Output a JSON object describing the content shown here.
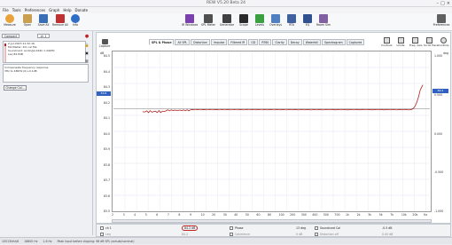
{
  "window": {
    "title": "REW V5.20 Beta 24"
  },
  "menu": [
    "File",
    "Tools",
    "Preferences",
    "Graph",
    "Help",
    "Donate"
  ],
  "toolbar": [
    {
      "label": "Measure",
      "color": "#e8a43a"
    },
    {
      "label": "Open",
      "color": "#c8a050"
    },
    {
      "label": "Save All",
      "color": "#3a6fb5"
    },
    {
      "label": "Remove All",
      "color": "#c03030"
    },
    {
      "label": "Info",
      "color": "#2f6ec4"
    },
    {
      "label": "IR Windows",
      "color": "#7a3fb0"
    },
    {
      "label": "SPL Meter",
      "color": "#505050"
    },
    {
      "label": "Generator",
      "color": "#404040"
    },
    {
      "label": "Scope",
      "color": "#2a2a2a"
    },
    {
      "label": "Levels",
      "color": "#3aa040"
    },
    {
      "label": "Overlays",
      "color": "#5080c0"
    },
    {
      "label": "RTA",
      "color": "#4060a0"
    },
    {
      "label": "EQ",
      "color": "#305090"
    },
    {
      "label": "Room Sim",
      "color": "#8060a0"
    },
    {
      "label": "Preferences",
      "color": "#606060"
    }
  ],
  "panel": {
    "compact_label": "Compact",
    "measurement_name": "ch 1",
    "info_lines": [
      "2-Jul-2023 21:32:16",
      "Mic/Meter: Rm cal file",
      "Soundcard: Audio/Jack44k 1.44KHz",
      "Leq 84.8dB"
    ],
    "notes_lines": [
      "Compensate frequency response",
      "3Hz to 48KHz (0/+0.1dB"
    ],
    "change_cal_label": "Change Cal..."
  },
  "graph": {
    "capture_label": "Capture",
    "tabs": [
      "SPL & Phase",
      "All SPL",
      "Distortion",
      "Impulse",
      "Filtered IR",
      "GD",
      "RT60",
      "Clarity",
      "Decay",
      "Waterfall",
      "Spectrogram",
      "Captured"
    ],
    "active_tab": "SPL & Phase",
    "tools": [
      "Controls",
      "Limits",
      "Freq. Axis",
      "Scroll Here",
      "Controls"
    ],
    "y_left_ticks": [
      "84.5",
      "84.4",
      "84.3",
      "84.2",
      "84.1",
      "84.0",
      "83.9",
      "83.8",
      "83.7",
      "83.6",
      "83.5"
    ],
    "y_right_ticks": [
      "1.000",
      "0.500",
      "0.000",
      "-0.500",
      "-1.000"
    ],
    "x_ticks": [
      "2",
      "3",
      "4",
      "5",
      "6",
      "7",
      "8",
      "9",
      "10",
      "20",
      "30",
      "40",
      "50",
      "60",
      "80",
      "100",
      "200",
      "300",
      "400",
      "500",
      "700",
      "1k",
      "2k",
      "3k",
      "5k",
      "7k",
      "10k",
      "20k",
      "Hz"
    ],
    "y_left_unit": "dB",
    "y_right_unit": "deg",
    "line_color": "#b02020",
    "ref_line_color": "#666666",
    "highlight_right": "84.2",
    "highlight_left": "83.8"
  },
  "legend": {
    "row1": [
      {
        "label": "ch 1",
        "value": "84.2 dB"
      },
      {
        "label": "Phase",
        "value": "13 deg"
      },
      {
        "label": "Soundcard Cal",
        "value": "-0.5 dB"
      }
    ],
    "row2": [
      {
        "label": "Leq",
        "value": "84.2"
      },
      {
        "label": "Coherence",
        "value": "0 dB"
      },
      {
        "label": "Distortion off",
        "value": "0.00 dB"
      }
    ],
    "highlight": "84.2 dB"
  },
  "status": [
    "10513kHz/6",
    "18800 Hz",
    "1.6 Hz",
    "Peak input before clipping: 98 dB SPL (actual/nominal)"
  ]
}
